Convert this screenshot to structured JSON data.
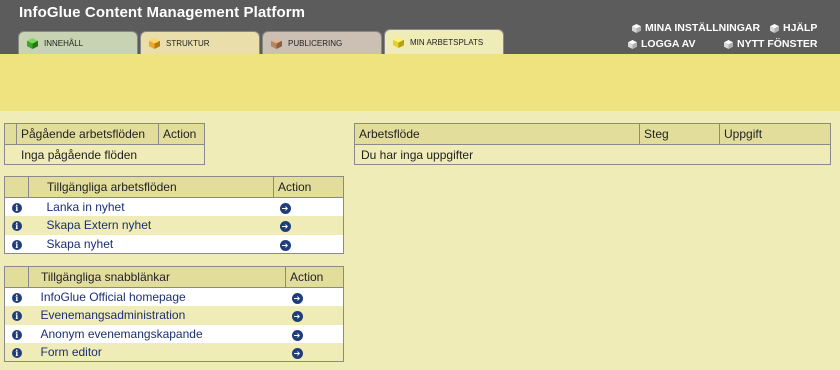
{
  "header": {
    "title": "InfoGlue Content Management Platform",
    "links": {
      "settings": "MINA INSTÄLLNINGAR",
      "help": "HJÄLP",
      "logout": "LOGGA AV",
      "new_window": "NYTT FÖNSTER"
    }
  },
  "tabs": [
    {
      "label": "INNEHÅLL",
      "icon": "green-cube-icon"
    },
    {
      "label": "STRUKTUR",
      "icon": "orange-cube-icon"
    },
    {
      "label": "PUBLICERING",
      "icon": "brown-cube-icon"
    },
    {
      "label": "MIN ARBETSPLATS",
      "icon": "yellow-cube-icon"
    }
  ],
  "ongoing": {
    "headers": [
      "Pågående arbetsflöden",
      "Action"
    ],
    "empty_text": "Inga pågående flöden"
  },
  "tasks": {
    "headers": [
      "Arbetsflöde",
      "Steg",
      "Uppgift"
    ],
    "empty_text": "Du har inga uppgifter"
  },
  "available_workflows": {
    "headers": [
      "Tillgängliga arbetsflöden",
      "Action"
    ],
    "items": [
      "Lanka in nyhet",
      "Skapa Extern nyhet",
      "Skapa nyhet"
    ]
  },
  "shortcuts": {
    "headers": [
      "Tillgängliga snabblänkar",
      "Action"
    ],
    "items": [
      "InfoGlue Official homepage",
      "Evenemangsadministration",
      "Anonym evenemangskapande",
      "Form editor"
    ]
  },
  "colors": {
    "header_bg": "#5c5c5c",
    "page_bg": "#efecb7",
    "toolbar_bg": "#efe380",
    "link": "#1c2f74"
  }
}
